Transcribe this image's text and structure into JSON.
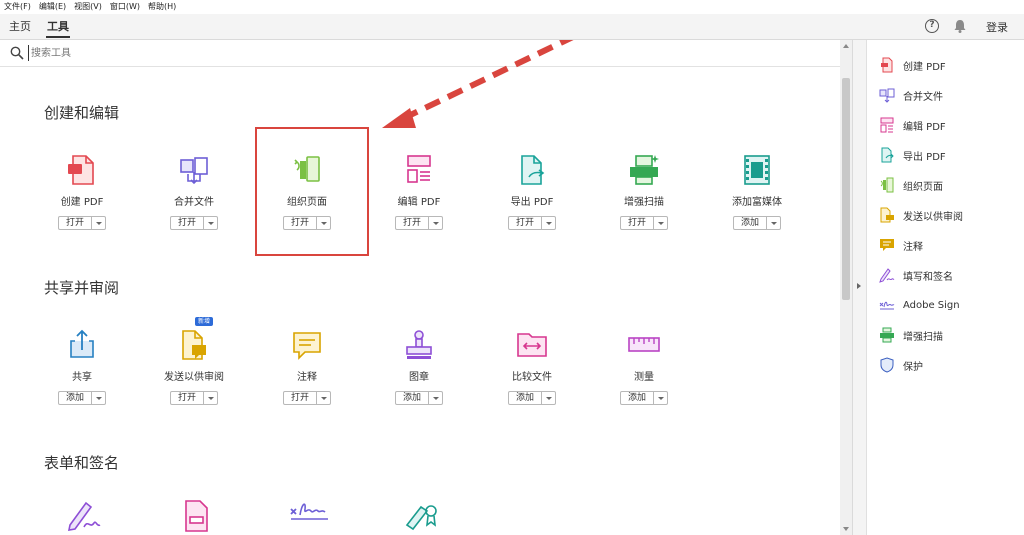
{
  "menu": [
    "文件(F)",
    "编辑(E)",
    "视图(V)",
    "窗口(W)",
    "帮助(H)"
  ],
  "tabs": {
    "home": "主页",
    "tools": "工具"
  },
  "header": {
    "help": "?",
    "login": "登录"
  },
  "search": {
    "placeholder": "搜索工具"
  },
  "sections": [
    {
      "title": "创建和编辑",
      "tools": [
        {
          "label": "创建 PDF",
          "button": "打开"
        },
        {
          "label": "合并文件",
          "button": "打开"
        },
        {
          "label": "组织页面",
          "button": "打开"
        },
        {
          "label": "编辑 PDF",
          "button": "打开"
        },
        {
          "label": "导出 PDF",
          "button": "打开"
        },
        {
          "label": "增强扫描",
          "button": "打开"
        },
        {
          "label": "添加富媒体",
          "button": "添加"
        }
      ]
    },
    {
      "title": "共享并审阅",
      "tools": [
        {
          "label": "共享",
          "button": "添加"
        },
        {
          "label": "发送以供审阅",
          "button": "打开",
          "badge": "新增"
        },
        {
          "label": "注释",
          "button": "打开"
        },
        {
          "label": "图章",
          "button": "添加"
        },
        {
          "label": "比较文件",
          "button": "添加"
        },
        {
          "label": "测量",
          "button": "添加"
        }
      ]
    },
    {
      "title": "表单和签名",
      "tools": []
    }
  ],
  "right_panel": [
    {
      "label": "创建 PDF",
      "icon": "create-pdf-icon"
    },
    {
      "label": "合并文件",
      "icon": "combine-files-icon"
    },
    {
      "label": "编辑 PDF",
      "icon": "edit-pdf-icon"
    },
    {
      "label": "导出 PDF",
      "icon": "export-pdf-icon"
    },
    {
      "label": "组织页面",
      "icon": "organize-pages-icon"
    },
    {
      "label": "发送以供审阅",
      "icon": "send-review-icon"
    },
    {
      "label": "注释",
      "icon": "comment-icon"
    },
    {
      "label": "填写和签名",
      "icon": "fill-sign-icon"
    },
    {
      "label": "Adobe Sign",
      "icon": "adobe-sign-icon"
    },
    {
      "label": "增强扫描",
      "icon": "enhance-scan-icon"
    },
    {
      "label": "保护",
      "icon": "protect-icon"
    }
  ],
  "colors": {
    "highlight": "#d9453e",
    "arrow": "#d9453e",
    "badge": "#2d6bd8"
  }
}
